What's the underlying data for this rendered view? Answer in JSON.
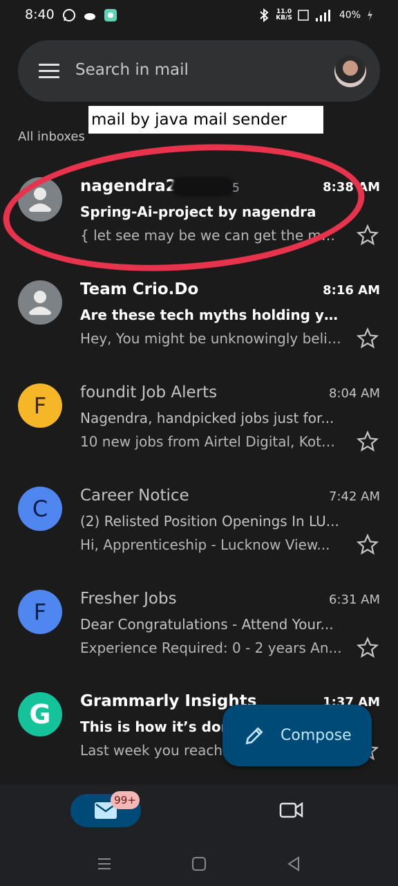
{
  "status_bar": {
    "time": "8:40",
    "net_speed": "11.0",
    "net_unit": "KB/S",
    "battery": "40%"
  },
  "search": {
    "placeholder": "Search in mail"
  },
  "annotation_label": "mail by java mail sender",
  "section_label": "All inboxes",
  "emails": [
    {
      "sender": "nagendra2",
      "sender_tail": "5",
      "time": "8:38 AM",
      "subject": "Spring-Ai-project by nagendra",
      "snippet": "{ let see may be we can get the ma...",
      "avatar": "person-icon",
      "unread": true
    },
    {
      "sender": "Team Crio.Do",
      "time": "8:16 AM",
      "subject": "Are these tech myths holding yo...",
      "snippet": "Hey, You might be unknowingly belie...",
      "avatar": "person-icon",
      "unread": true
    },
    {
      "sender": "foundit Job Alerts",
      "time": "8:04 AM",
      "subject": "Nagendra, handpicked jobs just for...",
      "snippet": "10 new jobs from Airtel Digital, Kota...",
      "avatar_letter": "F",
      "avatar_color": "#f5b727",
      "unread": false
    },
    {
      "sender": "Career Notice",
      "time": "7:42 AM",
      "subject": "(2) Relisted Position Openings In LU...",
      "snippet": "Hi, Apprenticeship - Lucknow View...",
      "avatar_letter": "C",
      "avatar_color": "#4f86f0",
      "unread": false
    },
    {
      "sender": "Fresher Jobs",
      "time": "6:31 AM",
      "subject": "Dear  Congratulations - Attend Your...",
      "snippet": "Experience Required: 0 - 2 years An...",
      "avatar_letter": "F",
      "avatar_color": "#4f86f0",
      "unread": false
    },
    {
      "sender": "Grammarly Insights",
      "time": "1:37 AM",
      "subject": "This is how it’s don",
      "snippet": "Last week you reach",
      "avatar_letter": "G",
      "avatar_color": "#15c39a",
      "unread": true
    }
  ],
  "compose": {
    "label": "Compose"
  },
  "bottom_nav": {
    "mail_badge": "99+"
  },
  "colors": {
    "annotation_circle": "#e8334c",
    "compose_bg": "#004a77"
  }
}
